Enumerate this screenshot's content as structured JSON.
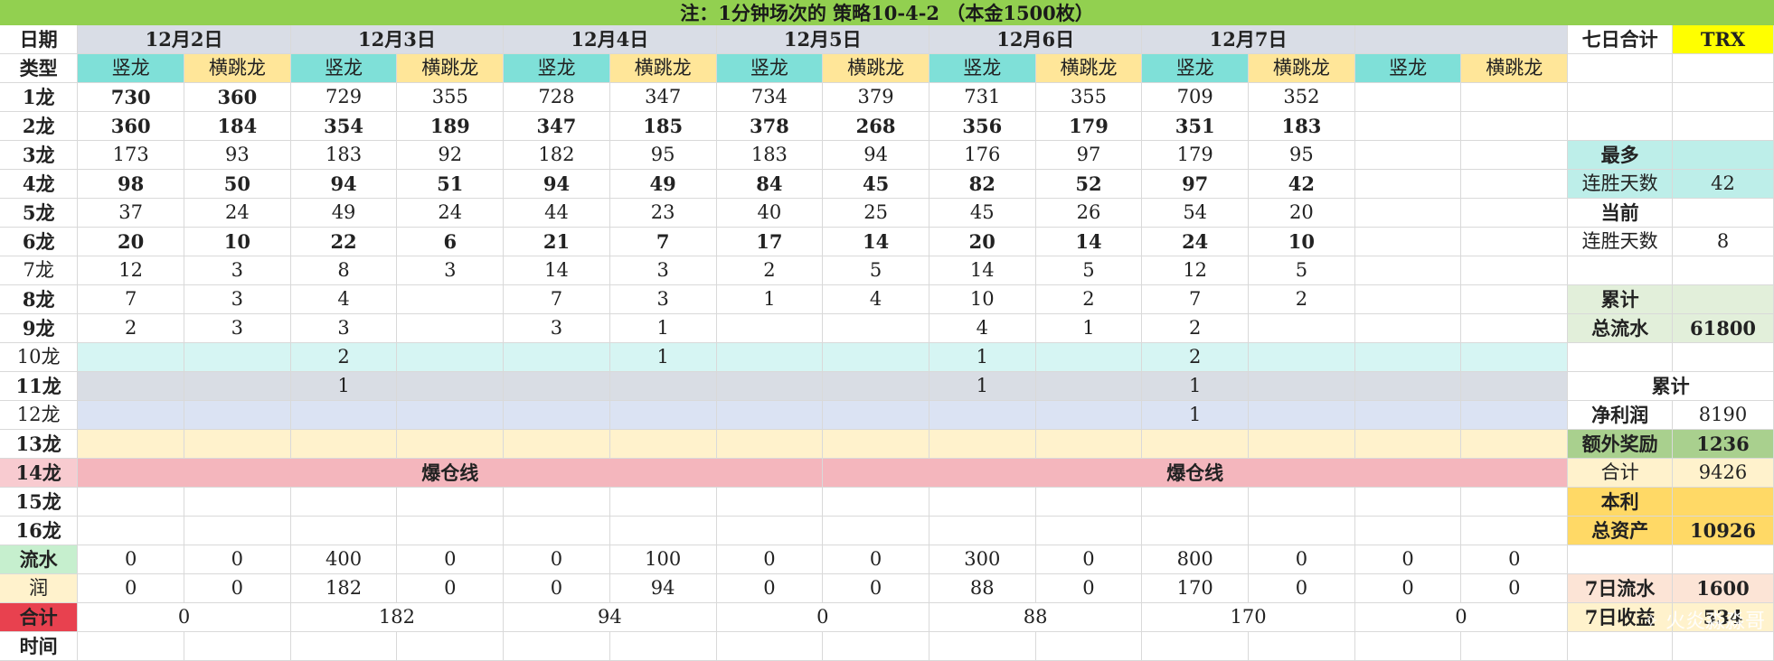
{
  "header": {
    "note": "注：1分钟场次的 策略10-4-2  （本金1500枚）"
  },
  "labels": {
    "date": "日期",
    "type": "类型",
    "burst": "爆仓线",
    "flow": "流水",
    "profit": "润",
    "total": "合计",
    "time": "时间"
  },
  "dates": [
    "12月2日",
    "12月3日",
    "12月4日",
    "12月5日",
    "12月6日",
    "12月7日"
  ],
  "column_types": [
    "竖龙",
    "横跳龙"
  ],
  "rows": [
    {
      "label": "1龙",
      "values": [
        "730",
        "360",
        "729",
        "355",
        "728",
        "347",
        "734",
        "379",
        "731",
        "355",
        "709",
        "352",
        "",
        ""
      ]
    },
    {
      "label": "2龙",
      "values": [
        "360",
        "184",
        "354",
        "189",
        "347",
        "185",
        "378",
        "268",
        "356",
        "179",
        "351",
        "183",
        "",
        ""
      ]
    },
    {
      "label": "3龙",
      "values": [
        "173",
        "93",
        "183",
        "92",
        "182",
        "95",
        "183",
        "94",
        "176",
        "97",
        "179",
        "95",
        "",
        ""
      ]
    },
    {
      "label": "4龙",
      "values": [
        "98",
        "50",
        "94",
        "51",
        "94",
        "49",
        "84",
        "45",
        "82",
        "52",
        "97",
        "42",
        "",
        ""
      ]
    },
    {
      "label": "5龙",
      "values": [
        "37",
        "24",
        "49",
        "24",
        "44",
        "23",
        "40",
        "25",
        "45",
        "26",
        "54",
        "20",
        "",
        ""
      ]
    },
    {
      "label": "6龙",
      "values": [
        "20",
        "10",
        "22",
        "6",
        "21",
        "7",
        "17",
        "14",
        "20",
        "14",
        "24",
        "10",
        "",
        ""
      ]
    },
    {
      "label": "7龙",
      "values": [
        "12",
        "3",
        "8",
        "3",
        "14",
        "3",
        "2",
        "5",
        "14",
        "5",
        "12",
        "5",
        "",
        ""
      ]
    },
    {
      "label": "8龙",
      "values": [
        "7",
        "3",
        "4",
        "",
        "7",
        "3",
        "1",
        "4",
        "10",
        "2",
        "7",
        "2",
        "",
        ""
      ]
    },
    {
      "label": "9龙",
      "values": [
        "2",
        "3",
        "3",
        "",
        "3",
        "1",
        "",
        "",
        "4",
        "1",
        "2",
        "",
        "",
        ""
      ]
    },
    {
      "label": "10龙",
      "values": [
        "",
        "",
        "2",
        "",
        "",
        "1",
        "",
        "",
        "1",
        "",
        "2",
        "",
        "",
        ""
      ]
    },
    {
      "label": "11龙",
      "values": [
        "",
        "",
        "1",
        "",
        "",
        "",
        "",
        "",
        "1",
        "",
        "1",
        "",
        "",
        ""
      ]
    },
    {
      "label": "12龙",
      "values": [
        "",
        "",
        "",
        "",
        "",
        "",
        "",
        "",
        "",
        "",
        "1",
        "",
        "",
        ""
      ]
    },
    {
      "label": "13龙",
      "values": [
        "",
        "",
        "",
        "",
        "",
        "",
        "",
        "",
        "",
        "",
        "",
        "",
        "",
        ""
      ]
    },
    {
      "label": "14龙",
      "values": []
    },
    {
      "label": "15龙",
      "values": [
        "",
        "",
        "",
        "",
        "",
        "",
        "",
        "",
        "",
        "",
        "",
        "",
        "",
        ""
      ]
    },
    {
      "label": "16龙",
      "values": [
        "",
        "",
        "",
        "",
        "",
        "",
        "",
        "",
        "",
        "",
        "",
        "",
        "",
        ""
      ]
    }
  ],
  "flow": [
    "0",
    "0",
    "400",
    "0",
    "0",
    "100",
    "0",
    "0",
    "300",
    "0",
    "800",
    "0",
    "0",
    "0"
  ],
  "profit": [
    "0",
    "0",
    "182",
    "0",
    "0",
    "94",
    "0",
    "0",
    "88",
    "0",
    "170",
    "0",
    "0",
    "0"
  ],
  "totals": [
    "0",
    "182",
    "94",
    "0",
    "88",
    "170",
    "0"
  ],
  "side": {
    "seven_day_total": "七日合计",
    "currency": "TRX",
    "most": "最多",
    "win_streak_days": "连胜天数",
    "max_streak": "42",
    "current": "当前",
    "current_streak": "8",
    "cumulative": "累计",
    "total_flow_label": "总流水",
    "total_flow": "61800",
    "net_profit_label": "净利润",
    "net_profit": "8190",
    "bonus_label": "额外奖励",
    "bonus": "1236",
    "sum_label": "合计",
    "sum": "9426",
    "principal_profit": "本利",
    "total_assets_label": "总资产",
    "total_assets": "10926",
    "flow7_label": "7日流水",
    "flow7": "1600",
    "income7_label": "7日收益",
    "income7": "534"
  },
  "watermark": "火炎淼淼哥"
}
